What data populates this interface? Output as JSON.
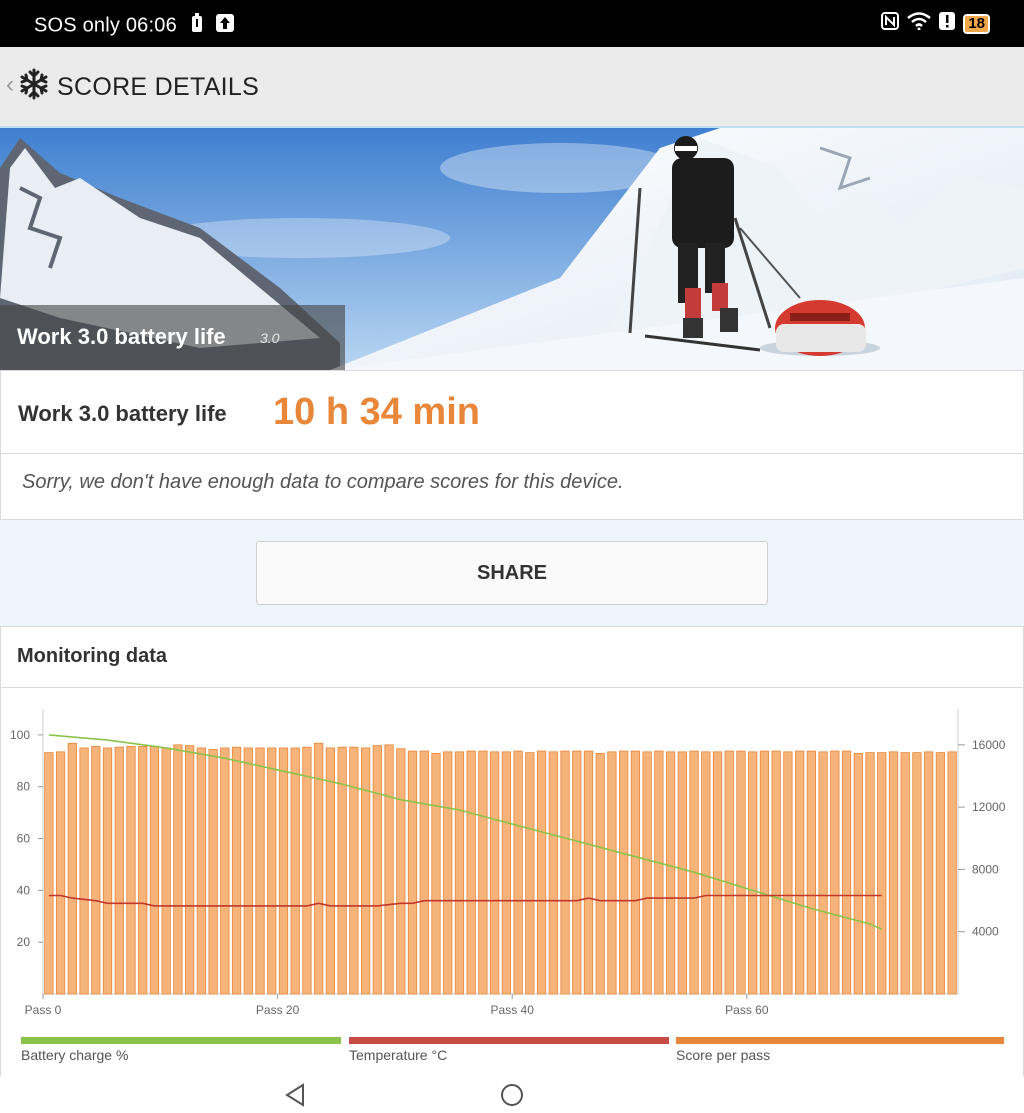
{
  "status_bar": {
    "carrier": "SOS only",
    "time": "06:06",
    "battery_level": "18"
  },
  "app_bar": {
    "title": "SCORE DETAILS"
  },
  "hero": {
    "title": "Work 3.0 battery life",
    "version": "3.0"
  },
  "score": {
    "label": "Work 3.0 battery life",
    "value": "10 h 34 min",
    "note": "Sorry, we don't have enough data to compare scores for this device."
  },
  "share": {
    "label": "SHARE"
  },
  "monitoring": {
    "title": "Monitoring data"
  },
  "colors": {
    "accent": "#e8873a",
    "battery_line": "#8bc34a",
    "temperature_line": "#c0392b",
    "score_bar": "#f0a15a"
  },
  "chart_data": {
    "type": "bar",
    "x_tick_labels": [
      "Pass 0",
      "Pass 20",
      "Pass 40",
      "Pass 60"
    ],
    "x_ticks": [
      0,
      20,
      40,
      60
    ],
    "left_axis": {
      "ticks": [
        20,
        40,
        60,
        80,
        100
      ],
      "ylim": [
        0,
        110
      ]
    },
    "right_axis": {
      "ticks": [
        4000,
        8000,
        12000,
        16000
      ],
      "ylim": [
        0,
        18300
      ]
    },
    "legend": [
      "Battery charge %",
      "Temperature °C",
      "Score per pass"
    ],
    "score_per_pass": [
      15500,
      15550,
      16100,
      15800,
      15900,
      15800,
      15850,
      15900,
      15900,
      15900,
      15800,
      16000,
      15950,
      15800,
      15700,
      15800,
      15850,
      15800,
      15800,
      15800,
      15800,
      15800,
      15850,
      16100,
      15800,
      15850,
      15850,
      15800,
      15950,
      16000,
      15750,
      15600,
      15600,
      15450,
      15550,
      15550,
      15600,
      15600,
      15550,
      15550,
      15600,
      15500,
      15600,
      15550,
      15600,
      15600,
      15600,
      15450,
      15550,
      15600,
      15600,
      15550,
      15600,
      15550,
      15550,
      15600,
      15550,
      15550,
      15600,
      15600,
      15550,
      15600,
      15600,
      15550,
      15600,
      15600,
      15550,
      15600,
      15600,
      15450,
      15500,
      15500,
      15550,
      15500,
      15500,
      15550,
      15500,
      15550
    ],
    "battery_pct": [
      [
        0,
        100
      ],
      [
        5,
        98
      ],
      [
        10,
        95
      ],
      [
        15,
        91
      ],
      [
        20,
        86
      ],
      [
        25,
        81
      ],
      [
        30,
        75
      ],
      [
        35,
        71
      ],
      [
        40,
        65
      ],
      [
        45,
        59
      ],
      [
        50,
        53
      ],
      [
        55,
        47
      ],
      [
        60,
        40
      ],
      [
        65,
        33
      ],
      [
        70,
        27
      ],
      [
        71,
        25
      ]
    ],
    "temperature": [
      [
        0,
        38
      ],
      [
        1,
        38
      ],
      [
        2,
        37
      ],
      [
        4,
        36
      ],
      [
        5,
        35
      ],
      [
        8,
        35
      ],
      [
        9,
        34
      ],
      [
        10,
        34
      ],
      [
        22,
        34
      ],
      [
        23,
        35
      ],
      [
        24,
        34
      ],
      [
        28,
        34
      ],
      [
        30,
        35
      ],
      [
        31,
        35
      ],
      [
        32,
        36
      ],
      [
        40,
        36
      ],
      [
        45,
        36
      ],
      [
        46,
        37
      ],
      [
        47,
        36
      ],
      [
        50,
        36
      ],
      [
        51,
        37
      ],
      [
        55,
        37
      ],
      [
        56,
        38
      ],
      [
        71,
        38
      ]
    ]
  }
}
